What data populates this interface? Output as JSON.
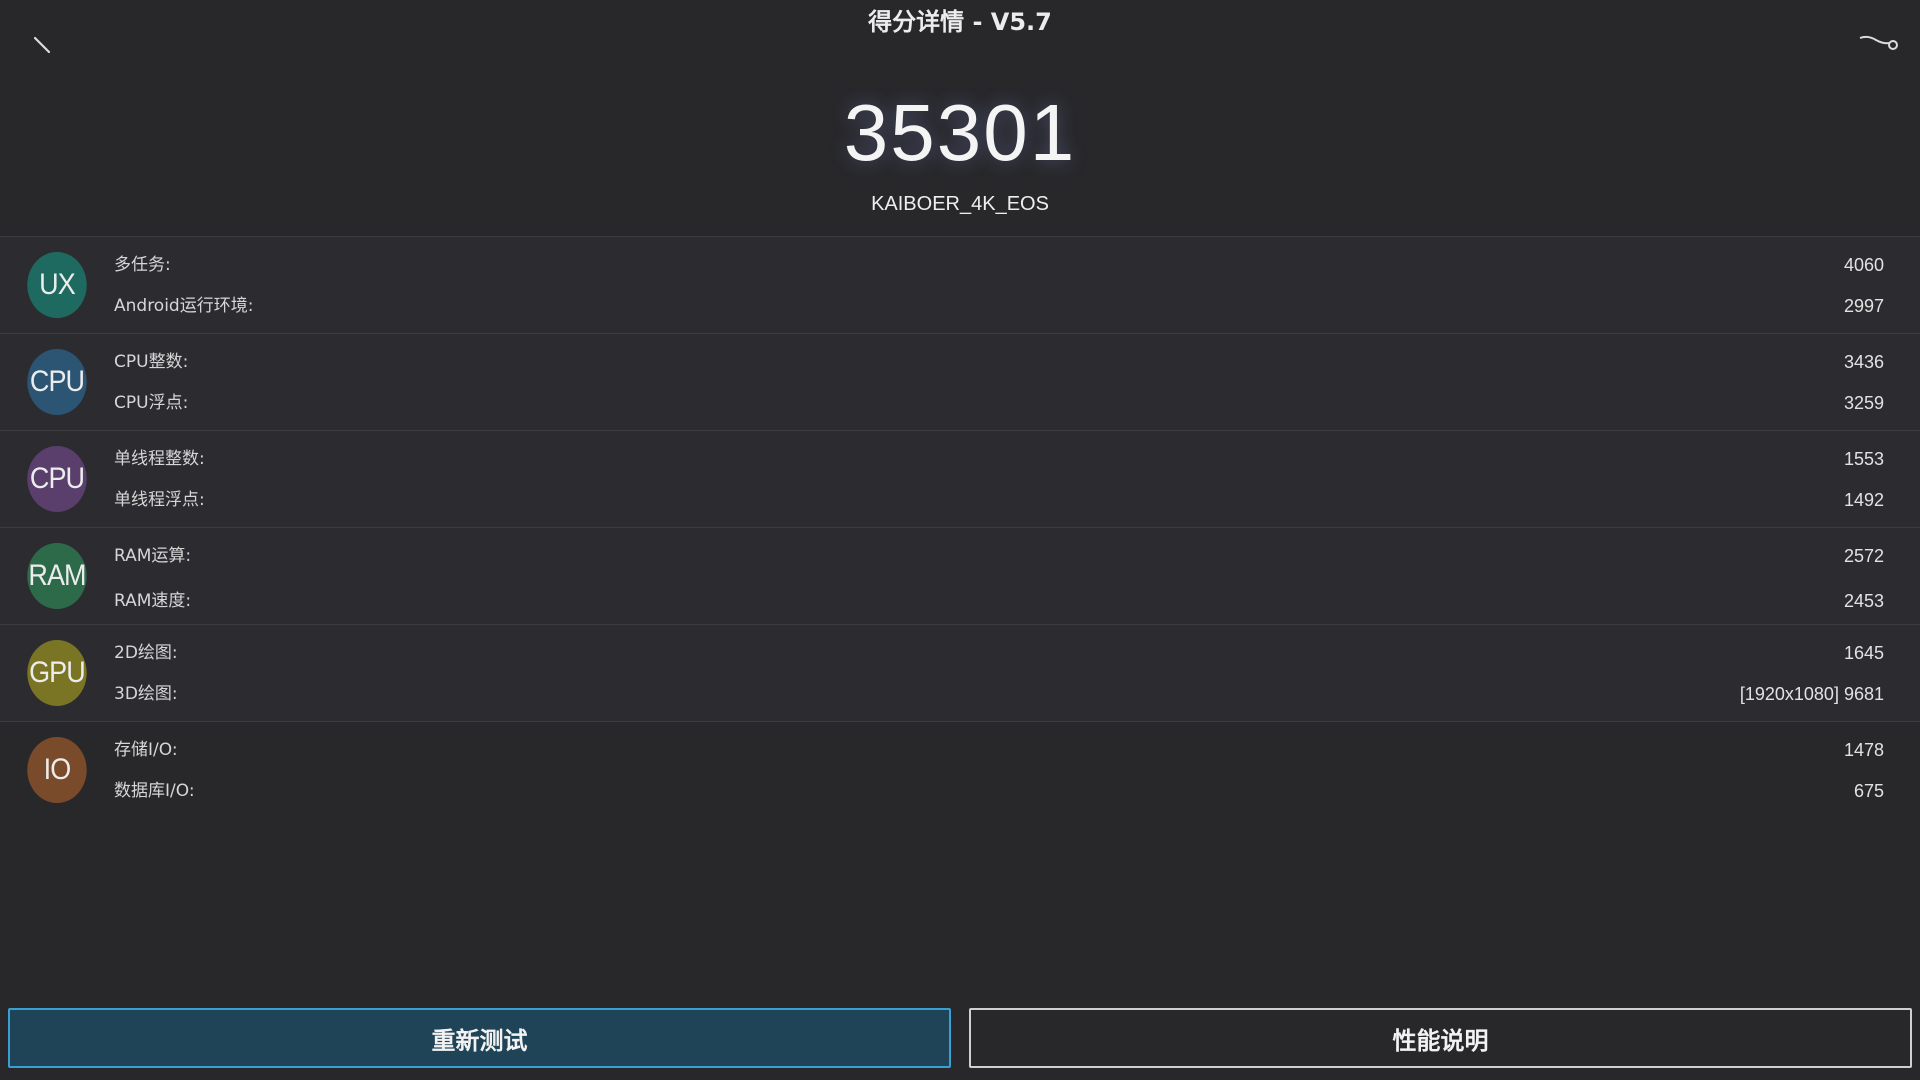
{
  "header": {
    "title": "得分详情 - V5.7",
    "back_icon": "back-arrow-icon",
    "share_icon": "share-icon"
  },
  "summary": {
    "total_score": "35301",
    "device_name": "KAIBOER_4K_EOS"
  },
  "categories": [
    {
      "badge": "UX",
      "badge_color": "#1e6a61",
      "items": [
        {
          "label": "多任务:",
          "value": "4060"
        },
        {
          "label": "Android运行环境:",
          "value": "2997"
        }
      ]
    },
    {
      "badge": "CPU",
      "badge_color": "#2c5574",
      "items": [
        {
          "label": "CPU整数:",
          "value": "3436"
        },
        {
          "label": "CPU浮点:",
          "value": "3259"
        }
      ]
    },
    {
      "badge": "CPU",
      "badge_color": "#5a3f6d",
      "items": [
        {
          "label": "单线程整数:",
          "value": "1553"
        },
        {
          "label": "单线程浮点:",
          "value": "1492"
        }
      ]
    },
    {
      "badge": "RAM",
      "badge_color": "#2c6a4a",
      "items": [
        {
          "label": "RAM运算:",
          "value": "2572"
        },
        {
          "label": "RAM速度:",
          "value": "2453"
        }
      ]
    },
    {
      "badge": "GPU",
      "badge_color": "#7a7425",
      "items": [
        {
          "label": "2D绘图:",
          "value": "1645"
        },
        {
          "label": "3D绘图:",
          "value": "[1920x1080] 9681"
        }
      ]
    },
    {
      "badge": "IO",
      "badge_color": "#7a4b2a",
      "items": [
        {
          "label": "存储I/O:",
          "value": "1478"
        },
        {
          "label": "数据库I/O:",
          "value": "675"
        }
      ]
    }
  ],
  "footer": {
    "retest_label": "重新测试",
    "info_label": "性能说明",
    "retest_color": "#1f4357",
    "retest_border": "#3a9fd1"
  }
}
